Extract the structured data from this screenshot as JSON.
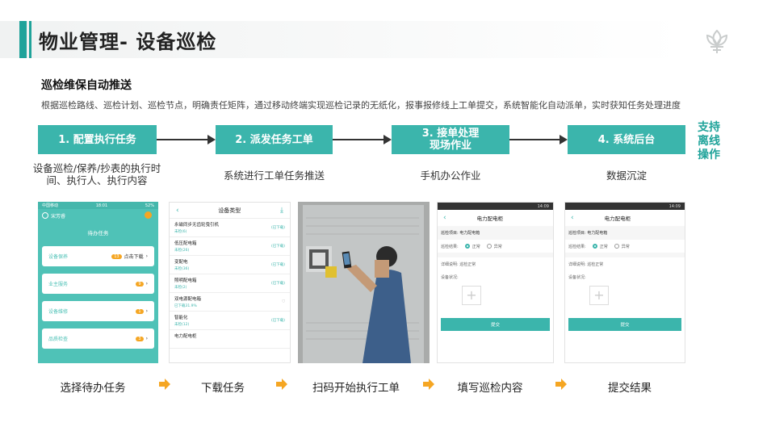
{
  "header": {
    "title": "物业管理- 设备巡检"
  },
  "section": {
    "title": "巡检维保自动推送",
    "desc": "根据巡检路线、巡检计划、巡检节点，明确责任矩阵，通过移动终端实现巡检记录的无纸化，报事报修线上工单提交，系统智能化自动派单，实时获知任务处理进度"
  },
  "steps": [
    {
      "label": "1. 配置执行任务",
      "caption": "设备巡检/保养/抄表的执行时间、执行人、执行内容"
    },
    {
      "label": "2. 派发任务工单",
      "caption": "系统进行工单任务推送"
    },
    {
      "label": "3. 接单处理\n现场作业",
      "caption": "手机办公作业"
    },
    {
      "label": "4. 系统后台",
      "caption": "数据沉淀"
    }
  ],
  "offline_note": "支持\n离线\n操作",
  "phone1": {
    "status_left": "中国移动",
    "time": "18:01",
    "status_right": "52%",
    "user": "宋芳睿",
    "title": "待办任务",
    "tasks": [
      {
        "name": "设备保养",
        "count": "13",
        "action": "点击下载"
      },
      {
        "name": "业主服务",
        "count": "9",
        "action": ""
      },
      {
        "name": "设备维修",
        "count": "1",
        "action": ""
      },
      {
        "name": "品质检查",
        "count": "3",
        "action": ""
      }
    ]
  },
  "phone2": {
    "title": "设备类型",
    "rows": [
      {
        "name": "永磁同步无齿轮曳引机",
        "sub": "未检(6)",
        "status": "(已下载)"
      },
      {
        "name": "低压配电箱",
        "sub": "未检(26)",
        "status": "(已下载)"
      },
      {
        "name": "变配电",
        "sub": "未检(36)",
        "status": "(已下载)"
      },
      {
        "name": "照明配电箱",
        "sub": "未检(2)",
        "status": "(已下载)"
      },
      {
        "name": "双电源配电箱",
        "sub": "已下载31.9%",
        "status": ""
      },
      {
        "name": "智能化",
        "sub": "未检(12)",
        "status": "(已下载)"
      },
      {
        "name": "电力配电柜",
        "sub": "",
        "status": ""
      }
    ]
  },
  "form_phone": {
    "time": "14:09",
    "title": "电力配电柜",
    "item_label": "巡检项目:",
    "item_value": "电力配电箱",
    "result_label": "巡检结果:",
    "opt_normal": "正常",
    "opt_abnormal": "异常",
    "detail_label": "详细说明:",
    "detail_value": "巡检正常",
    "status_label": "设备状况:",
    "submit": "提交"
  },
  "bottom_steps": [
    "选择待办任务",
    "下载任务",
    "扫码开始执行工单",
    "填写巡检内容",
    "提交结果"
  ],
  "colors": {
    "accent": "#3bb5ac",
    "arrow": "#f5a623"
  }
}
